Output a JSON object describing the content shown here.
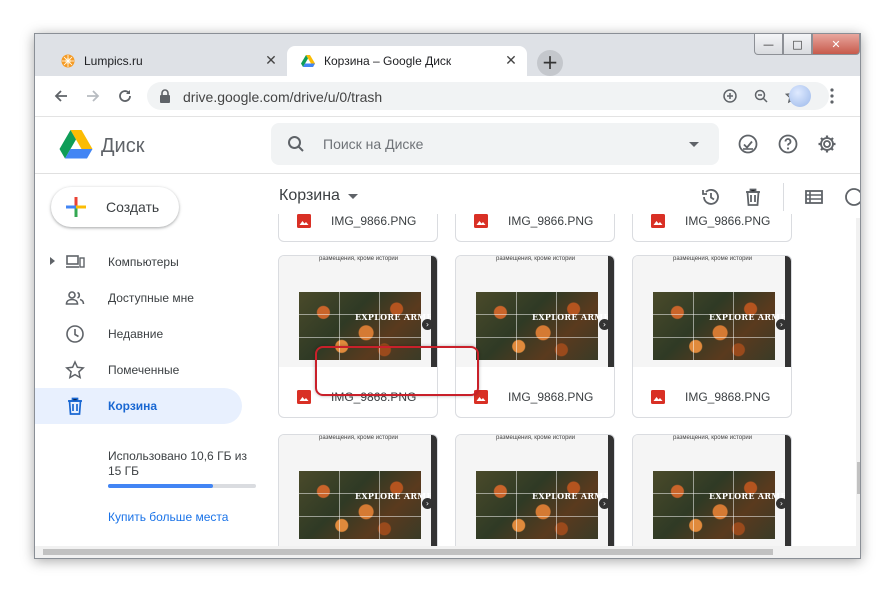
{
  "browser": {
    "tabs": [
      {
        "title": "Lumpics.ru",
        "favicon": "orange-icon"
      },
      {
        "title": "Корзина – Google Диск",
        "favicon": "google-drive-icon"
      }
    ],
    "new_tab": "+",
    "url": "drive.google.com/drive/u/0/trash"
  },
  "drive": {
    "title": "Диск",
    "search_placeholder": "Поиск на Диске",
    "create_label": "Создать",
    "nav": [
      {
        "label": "Компьютеры",
        "icon": "computers-icon",
        "active": false
      },
      {
        "label": "Доступные мне",
        "icon": "shared-icon",
        "active": false
      },
      {
        "label": "Недавние",
        "icon": "clock-icon",
        "active": false
      },
      {
        "label": "Помеченные",
        "icon": "star-icon",
        "active": false
      },
      {
        "label": "Корзина",
        "icon": "trash-icon",
        "active": true
      }
    ],
    "storage": {
      "text": "Использовано 10,6 ГБ из 15 ГБ",
      "used_fraction": 0.707,
      "buy_more": "Купить больше места"
    },
    "breadcrumb": "Корзина",
    "thumb_caption": "размещения, кроме истории",
    "thumb_overlay": "EXPLORE ARMENIA",
    "files_top": [
      "IMG_9866.PNG",
      "IMG_9866.PNG",
      "IMG_9866.PNG"
    ],
    "files_row": [
      "IMG_9868.PNG",
      "IMG_9868.PNG",
      "IMG_9868.PNG"
    ]
  },
  "colors": {
    "accent": "#1a73e8",
    "active_nav_bg": "#e8f0fe",
    "highlight": "#c9202a",
    "file_icon": "#d93025"
  }
}
